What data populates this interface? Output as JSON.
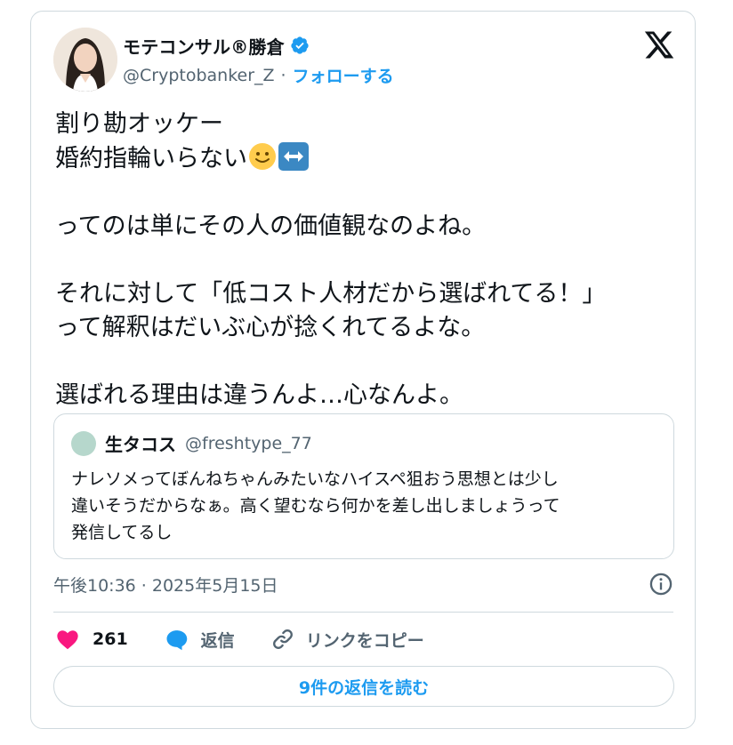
{
  "author": {
    "display_name": "モテコンサル®勝倉",
    "handle": "@Cryptobanker_Z",
    "separator": "·",
    "follow_label": "フォローする"
  },
  "tweet": {
    "text": "割り勘オッケー\n婚約指輪いらない🙂↔️\n\nってのは単にその人の価値観なのよね。\n\nそれに対して「低コスト人材だから選ばれてる！」\nって解釈はだいぶ心が捻くれてるよな。\n\n選ばれる理由は違うんよ…心なんよ。",
    "line1": "割り勘オッケー",
    "line2": "婚約指輪いらない",
    "line3": "ってのは単にその人の価値観なのよね。",
    "line4": "それに対して「低コスト人材だから選ばれてる！」",
    "line5": "って解釈はだいぶ心が捻くれてるよな。",
    "line6": "選ばれる理由は違うんよ…心なんよ。"
  },
  "quote": {
    "name": "生タコス",
    "handle": "@freshtype_77",
    "text": "ナレソメってぼんねちゃんみたいなハイスペ狙おう思想とは少し\n違いそうだからなぁ。高く望むなら何かを差し出しましょうって\n発信してるし"
  },
  "timestamp": "午後10:36 · 2025年5月15日",
  "actions": {
    "like_count": "261",
    "reply_label": "返信",
    "copy_link_label": "リンクをコピー"
  },
  "read_replies_label": "9件の返信を読む",
  "colors": {
    "accent": "#1d9bf0",
    "like": "#f91880",
    "secondary_text": "#536471",
    "border": "#cfd9de"
  },
  "icons": [
    "verified-badge-icon",
    "x-logo-icon",
    "info-icon",
    "heart-icon",
    "reply-bubble-icon",
    "link-icon"
  ]
}
